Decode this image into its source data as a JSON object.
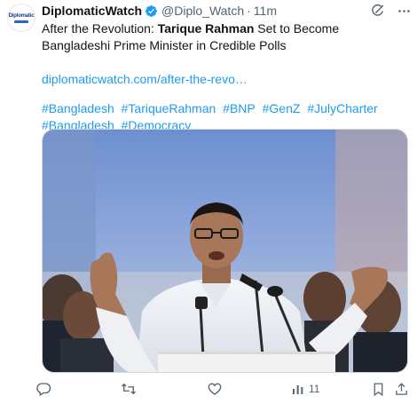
{
  "author": {
    "name": "DiplomaticWatch",
    "handle": "@Diplo_Watch",
    "separator": "·",
    "time": "11m",
    "avatar_text": "Diplomatic"
  },
  "tweet": {
    "text_before": "After the Revolution: ",
    "text_bold": "Tarique Rahman",
    "text_after": " Set to Become Bangladeshi Prime Minister in Credible Polls",
    "link": "diplomaticwatch.com/after-the-revo…",
    "hashtags": [
      "#Bangladesh",
      "#TariqueRahman",
      "#BNP",
      "#GenZ",
      "#JulyCharter",
      "#Bangladesh",
      "#Democracy"
    ]
  },
  "actions": {
    "views_count": "11"
  },
  "colors": {
    "accent": "#1d9bf0",
    "muted": "#536471",
    "text": "#0f1419"
  },
  "icons": {
    "verified": "verified-badge-icon",
    "grok": "grok-icon",
    "more": "more-icon",
    "reply": "reply-icon",
    "retweet": "retweet-icon",
    "like": "like-icon",
    "views": "views-icon",
    "bookmark": "bookmark-icon",
    "share": "share-icon"
  }
}
